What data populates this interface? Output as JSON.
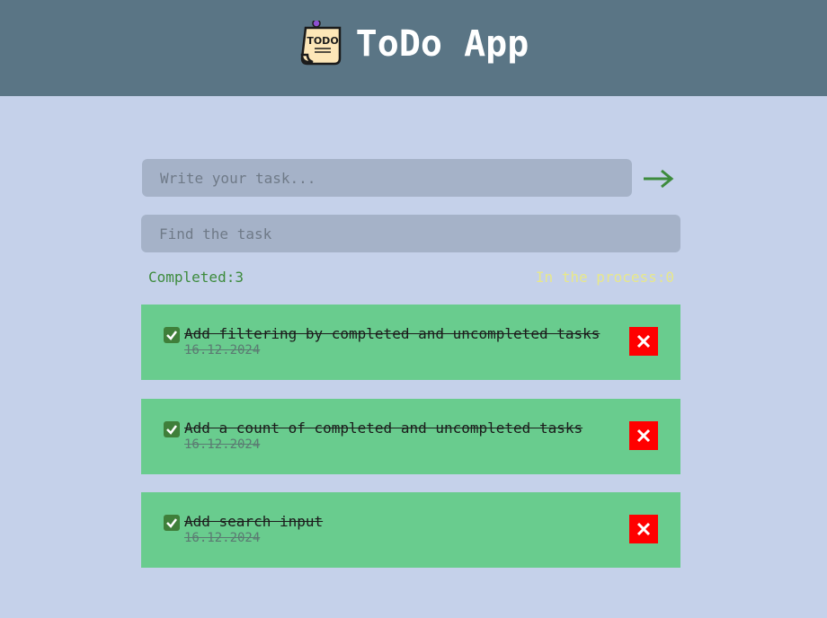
{
  "header": {
    "title": "ToDo App",
    "logo_text": "TODO",
    "logo_icon": "todo-note-icon"
  },
  "form": {
    "task_placeholder": "Write your task...",
    "submit_icon": "arrow-right-icon"
  },
  "search": {
    "placeholder": "Find the task"
  },
  "stats": {
    "completed": "Completed:3",
    "in_process": "In the process:0"
  },
  "tasks": [
    {
      "text": "Add filtering by completed and uncompleted tasks",
      "date": "16.12.2024",
      "completed": true
    },
    {
      "text": "Add a count of completed and uncompleted tasks",
      "date": "16.12.2024",
      "completed": true
    },
    {
      "text": "Add search input",
      "date": "16.12.2024",
      "completed": true
    }
  ],
  "colors": {
    "header_bg": "#5a7585",
    "page_bg": "#c5d1ea",
    "task_bg": "#69cc8e",
    "delete_bg": "#ff0000",
    "completed_text": "#3d8b3d",
    "process_text": "#e8e88a",
    "arrow": "#3d8b3d"
  }
}
